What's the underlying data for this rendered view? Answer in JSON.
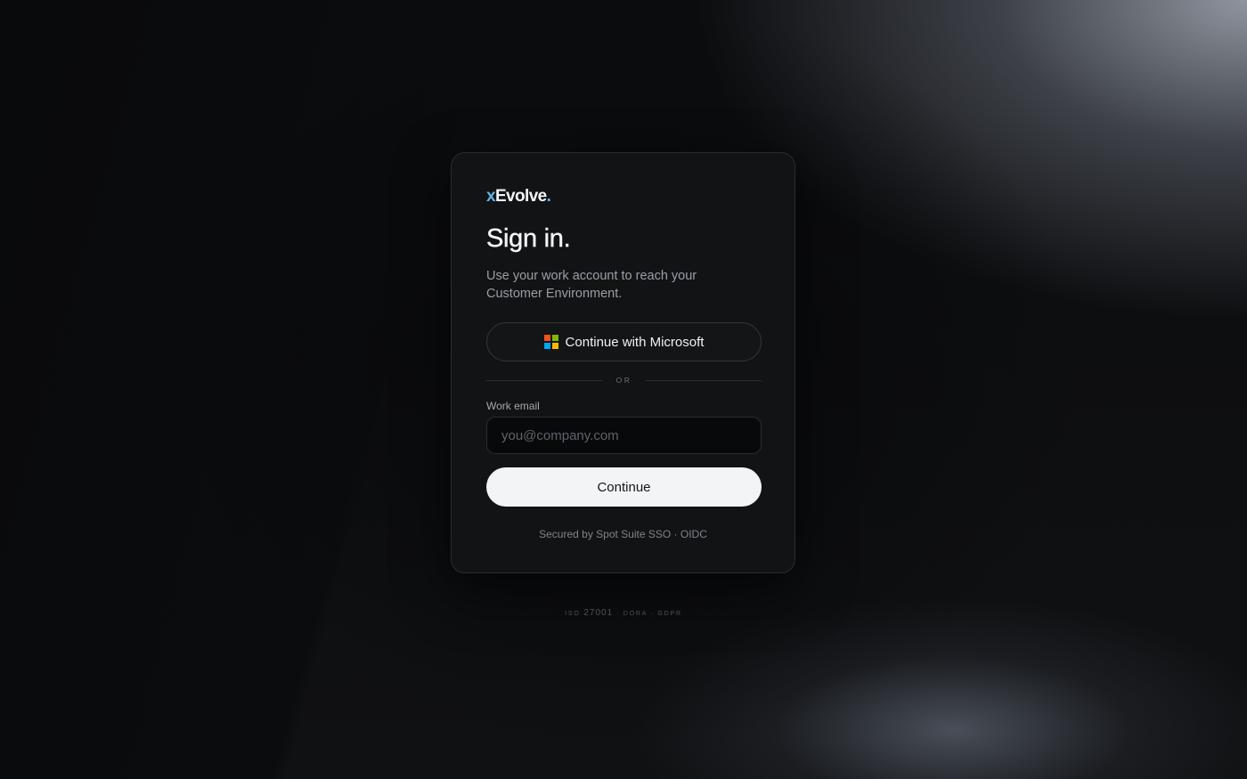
{
  "brand": {
    "logo_prefix": "x",
    "logo_name": "Evolve",
    "logo_suffix": ".",
    "accent_color": "#5fb6e8"
  },
  "signin": {
    "title": "Sign in.",
    "subtitle": "Use your work account to reach your Customer Environment.",
    "microsoft_button_label": "Continue with Microsoft",
    "microsoft_logo_colors": [
      "#f25022",
      "#7fba00",
      "#00a4ef",
      "#ffb900"
    ],
    "divider_text": "OR",
    "email_label": "Work email",
    "email_placeholder": "you@company.com",
    "email_value": "",
    "continue_label": "Continue",
    "secured_text": "Secured by Spot Suite SSO · OIDC"
  },
  "footer": {
    "compliance_prefix": "ISO ",
    "compliance_number": "27001",
    "compliance_suffix": " · DORA · GDPR"
  }
}
